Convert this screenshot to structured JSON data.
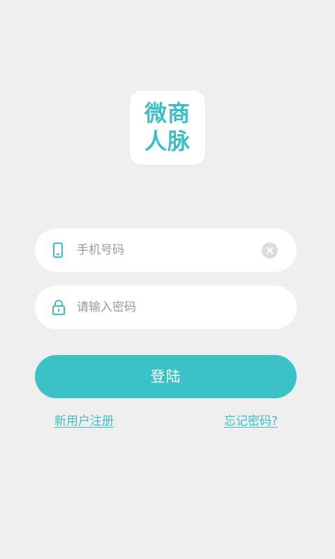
{
  "logo": {
    "line1": "微商",
    "line2": "人脉"
  },
  "phone_field": {
    "value": "",
    "placeholder": "手机号码",
    "icon": "phone-icon",
    "clear_icon": "clear-icon"
  },
  "password_field": {
    "value": "",
    "placeholder": "请输入密码",
    "icon": "lock-icon"
  },
  "login_button": {
    "label": "登陆"
  },
  "links": {
    "register": "新用户注册",
    "forgot": "忘记密码?"
  },
  "colors": {
    "accent": "#3bc2c6",
    "background": "#efefef",
    "field_background": "#ffffff",
    "placeholder": "#9a9a9a"
  }
}
